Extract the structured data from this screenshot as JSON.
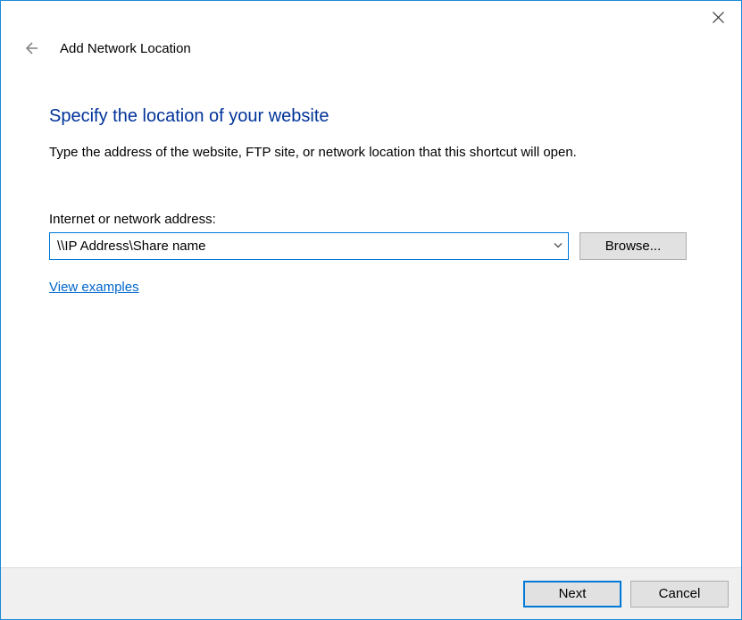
{
  "titlebar": {
    "close_label": "Close"
  },
  "header": {
    "wizard_title": "Add Network Location"
  },
  "main": {
    "heading": "Specify the location of your website",
    "instruction": "Type the address of the website, FTP site, or network location that this shortcut will open.",
    "address_label": "Internet or network address:",
    "address_value": "\\\\IP Address\\Share name",
    "browse_label": "Browse...",
    "examples_label": "View examples"
  },
  "footer": {
    "next_label": "Next",
    "cancel_label": "Cancel"
  }
}
